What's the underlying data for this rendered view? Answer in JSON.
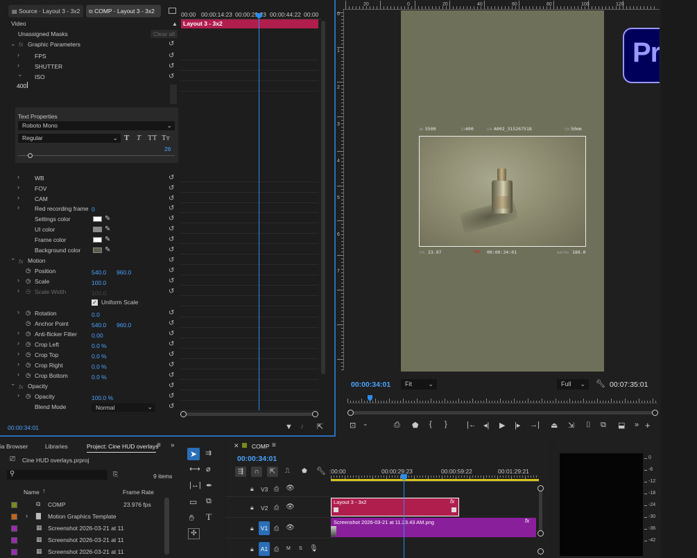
{
  "tabs": {
    "source": "Source · Layout 3 - 3x2",
    "comp": "COMP · Layout 3 - 3x2"
  },
  "ec": {
    "section": "Video",
    "masks": "Unassigned Masks",
    "clear": "Clear all",
    "graphic": "Graphic Parameters",
    "fps": "FPS",
    "shutter": "SHUTTER",
    "iso": "ISO",
    "iso_value": "400",
    "textprops": "Text Properties",
    "font": "Roboto Mono",
    "style": "Regular",
    "size": "26",
    "wb": "WB",
    "fov": "FOV",
    "cam": "CAM",
    "red_frame": "Red recording frame",
    "red_frame_val": "0",
    "settings_color": "Settings color",
    "ui_color": "UI color",
    "frame_color": "Frame color",
    "bg_color": "Background color",
    "motion": "Motion",
    "position": "Position",
    "pos_x": "540.0",
    "pos_y": "960.0",
    "scale": "Scale",
    "scale_val": "100.0",
    "scale_width": "Scale Width",
    "scale_width_val": "100.0",
    "uniform": "Uniform Scale",
    "rotation": "Rotation",
    "rotation_val": "0.0",
    "anchor": "Anchor Point",
    "anchor_x": "540.0",
    "anchor_y": "960.0",
    "antiflicker": "Anti-flicker Filter",
    "antiflicker_val": "0.00",
    "crop_left": "Crop Left",
    "crop_top": "Crop Top",
    "crop_right": "Crop Right",
    "crop_bottom": "Crop Bottom",
    "crop_val": "0.0 %",
    "opacity_section": "Opacity",
    "opacity": "Opacity",
    "opacity_val": "100.0 %",
    "blend": "Blend Mode",
    "blend_val": "Normal",
    "timecode": "00:00:34:01",
    "mini_times": [
      "00:00",
      "00:00:14:23",
      "00:00:29:23",
      "00:00:44:22",
      "00:00"
    ],
    "mini_clip": "Layout 3 - 3x2"
  },
  "program": {
    "ruler": [
      "20",
      "0",
      "20",
      "40",
      "60",
      "80",
      "100",
      "120"
    ],
    "vruler": [
      "0",
      "1",
      "2",
      "3",
      "4",
      "5",
      "6",
      "7"
    ],
    "hud": {
      "wb_label": "WB",
      "wb": "5500",
      "iso_label": "ISO",
      "iso": "400",
      "cam_label": "CAM",
      "cam": "A002_315267518",
      "fov_label": "FOV",
      "fov": "50mm",
      "fps_label": "FPS",
      "fps": "23.97",
      "rec_label": "REC",
      "tc": "00:00:34:01",
      "shutter_label": "SHUTTER",
      "shutter": "180.0"
    },
    "timecode": "00:00:34:01",
    "fit": "Fit",
    "quality": "Full",
    "duration": "00:07:35:01"
  },
  "logo": "Pr",
  "project": {
    "tabs": [
      "ia Browser",
      "Libraries",
      "Project: Cine HUD overlays"
    ],
    "file": "Cine HUD overlays.prproj",
    "items": "9 items",
    "col_name": "Name",
    "col_rate": "Frame Rate",
    "rows": [
      {
        "name": "COMP",
        "rate": "23.976 fps",
        "color": "#7a8a1f"
      },
      {
        "name": "Motion Graphics Template",
        "rate": "",
        "color": "#c4651c"
      },
      {
        "name": "Screenshot 2026-03-21 at 11",
        "rate": "",
        "color": "#9a2bb0"
      },
      {
        "name": "Screenshot 2026-03-21 at 11",
        "rate": "",
        "color": "#9a2bb0"
      },
      {
        "name": "Screenshot 2026-03-21 at 11",
        "rate": "",
        "color": "#9a2bb0"
      }
    ]
  },
  "timeline": {
    "tab": "COMP",
    "timecode": "00:00:34:01",
    "ruler": [
      ":00:00",
      "00:00:29:23",
      "00:00:59:22",
      "00:01:29:21"
    ],
    "tracks": [
      "V3",
      "V2",
      "V1",
      "A1"
    ],
    "clip_v2": "Layout 3 - 3x2",
    "clip_v1": "Screenshot 2026-03-21 at 11.23.43 AM.png",
    "meter": [
      "0",
      "-6",
      "-12",
      "-18",
      "-24",
      "-30",
      "-36",
      "-42"
    ]
  },
  "colors": {
    "accent": "#2d8ceb",
    "clip_red": "#b01e4e",
    "clip_purple": "#8a1f9c",
    "frame_bg": "#6e7059"
  }
}
